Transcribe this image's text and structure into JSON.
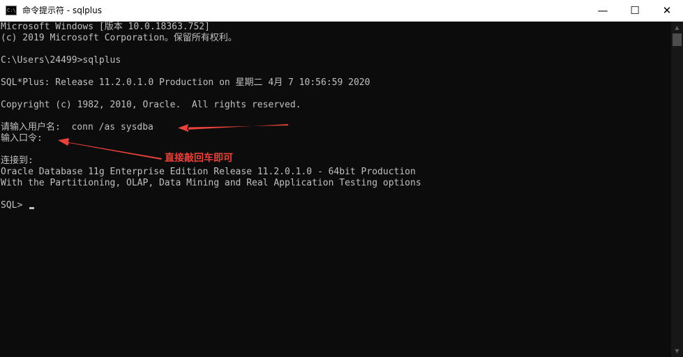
{
  "window": {
    "title": "命令提示符 - sqlplus",
    "icon": "cmd-icon",
    "icon_glyph": "C:\\",
    "controls": {
      "minimize": "—",
      "maximize": "☐",
      "close": "✕"
    }
  },
  "console": {
    "lines": [
      "Microsoft Windows [版本 10.0.18363.752]",
      "(c) 2019 Microsoft Corporation。保留所有权利。",
      "",
      "C:\\Users\\24499>sqlplus",
      "",
      "SQL*Plus: Release 11.2.0.1.0 Production on 星期二 4月 7 10:56:59 2020",
      "",
      "Copyright (c) 1982, 2010, Oracle.  All rights reserved.",
      "",
      "请输入用户名:  conn /as sysdba",
      "输入口令:",
      "",
      "连接到:",
      "Oracle Database 11g Enterprise Edition Release 11.2.0.1.0 - 64bit Production",
      "With the Partitioning, OLAP, Data Mining and Real Application Testing options",
      "",
      "SQL> "
    ]
  },
  "annotation": {
    "text": "直接敲回车即可",
    "color": "#e8423b"
  },
  "colors": {
    "console_bg": "#0c0c0c",
    "console_fg": "#c0c0c0",
    "titlebar_bg": "#ffffff"
  },
  "scrollbar": {
    "up": "▲",
    "down": "▼"
  }
}
